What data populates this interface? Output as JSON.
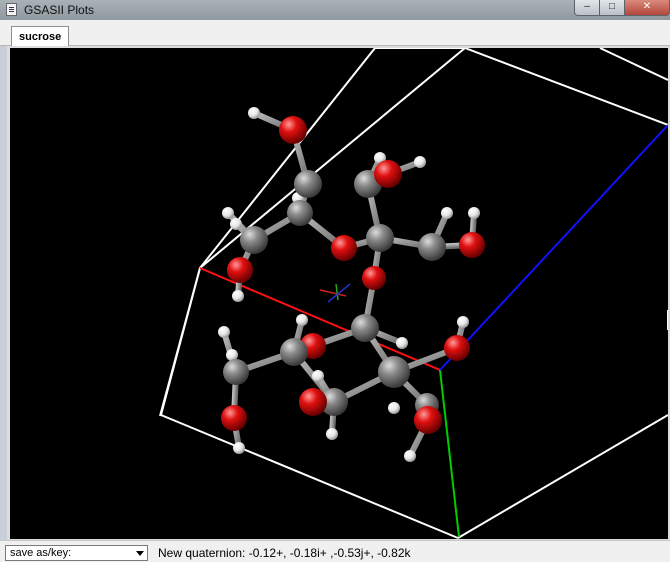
{
  "window": {
    "title": "GSASII Plots",
    "min_glyph": "–",
    "max_glyph": "□",
    "close_glyph": "✕"
  },
  "tabs": [
    {
      "label": "sucrose",
      "selected": true
    }
  ],
  "statusbar": {
    "save_select": "save as/key:",
    "message": "New quaternion: -0.12+, -0.18i+ ,-0.53j+, -0.82k"
  },
  "colors": {
    "carbon": "#777777",
    "oxygen": "#e01010",
    "hydrogen": "#ececec",
    "cell_edge": "#ffffff",
    "axis_a": "#ff0000",
    "axis_b": "#00cc00",
    "axis_c": "#0000ff",
    "background": "#000000"
  },
  "icons": {
    "app": "gsas-app-icon",
    "dropdown": "chevron-down-icon"
  }
}
